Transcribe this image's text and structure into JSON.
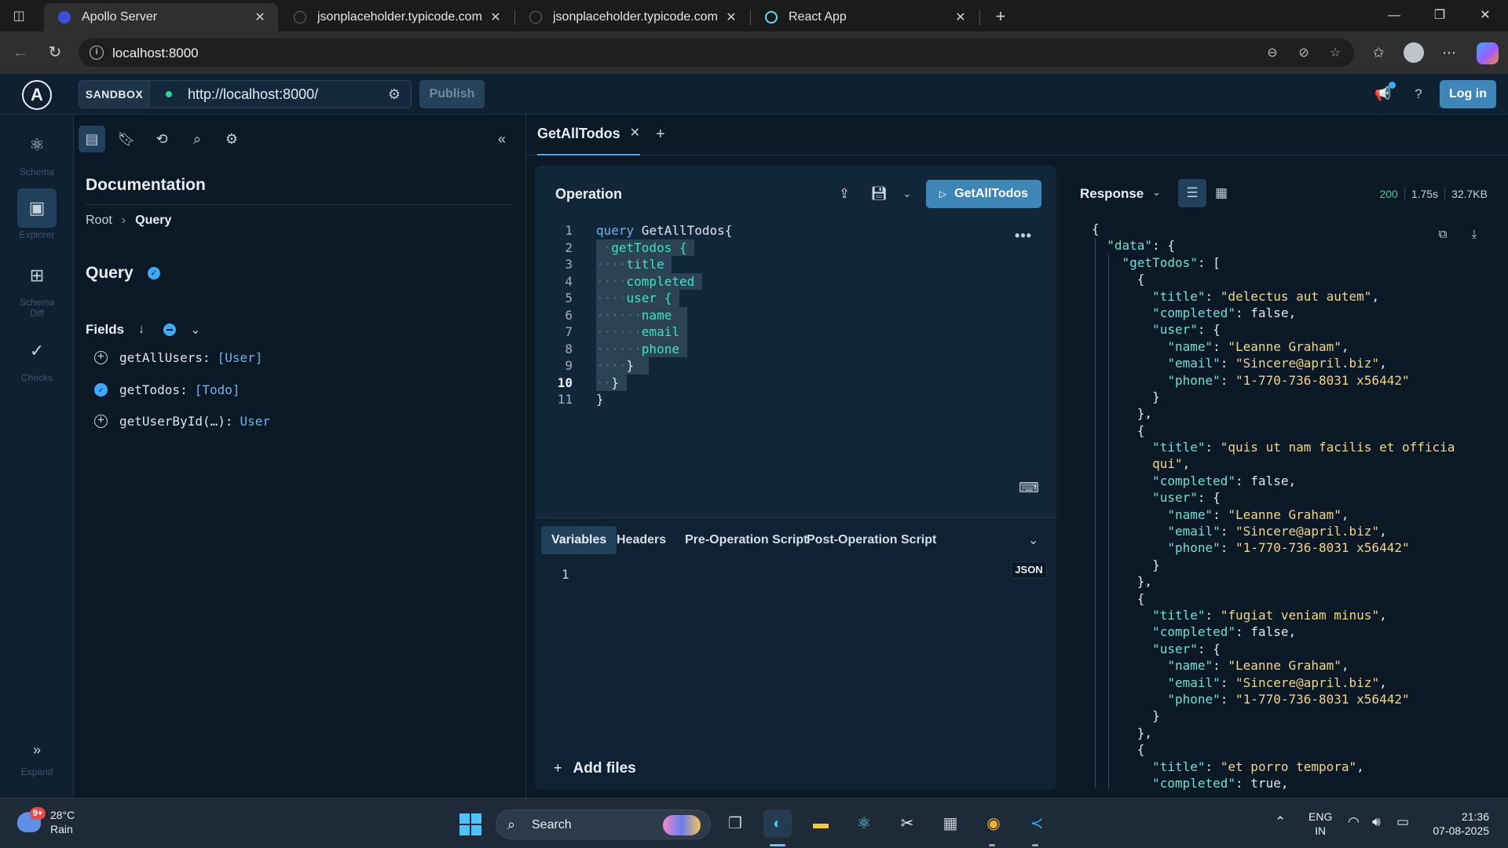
{
  "browser": {
    "tabs": [
      {
        "title": "Apollo Server",
        "active": true
      },
      {
        "title": "jsonplaceholder.typicode.com/to",
        "active": false
      },
      {
        "title": "jsonplaceholder.typicode.com/us",
        "active": false
      },
      {
        "title": "React App",
        "active": false
      }
    ],
    "address": "localhost:8000"
  },
  "header": {
    "sandbox_label": "SANDBOX",
    "endpoint": "http://localhost:8000/",
    "publish_label": "Publish",
    "login_label": "Log in"
  },
  "leftnav": {
    "items": [
      {
        "label": "Schema",
        "icon": "schema-icon"
      },
      {
        "label": "Explorer",
        "icon": "explorer-icon"
      },
      {
        "label": "Schema Diff",
        "icon": "schema-diff-icon"
      },
      {
        "label": "Checks",
        "icon": "checks-icon"
      }
    ],
    "expand_label": "Expand"
  },
  "docs": {
    "title": "Documentation",
    "breadcrumb": [
      "Root",
      "Query"
    ],
    "query_title": "Query",
    "fields_label": "Fields",
    "fields": [
      {
        "name": "getAllUsers:",
        "type": "[User]",
        "selected": false
      },
      {
        "name": "getTodos:",
        "type": "[Todo]",
        "selected": true
      },
      {
        "name": "getUserById(…):",
        "type": "User",
        "selected": false
      }
    ]
  },
  "operation_tab": {
    "label": "GetAllTodos"
  },
  "operation": {
    "title": "Operation",
    "run_label": "GetAllTodos",
    "line_numbers": [
      "1",
      "2",
      "3",
      "4",
      "5",
      "6",
      "7",
      "8",
      "9",
      "10",
      "11"
    ],
    "code": {
      "l1_kw": "query",
      "l1_name": " GetAllTodos{",
      "l2": "getTodos {",
      "l3": "title",
      "l4": "completed",
      "l5": "user {",
      "l6": "name",
      "l7": "email",
      "l8": "phone",
      "l9": "}",
      "l10": "}",
      "l11": "}"
    }
  },
  "variables": {
    "tabs": [
      "Variables",
      "Headers",
      "Pre-Operation Script",
      "Post-Operation Script"
    ],
    "badge": "JSON",
    "line1": "1",
    "add_files_label": "Add files"
  },
  "response": {
    "label": "Response",
    "status": "200",
    "time": "1.75s",
    "size": "32.7KB",
    "todos": [
      {
        "title": "delectus aut autem",
        "completed": "false",
        "name": "Leanne Graham",
        "email": "Sincere@april.biz",
        "phone": "1-770-736-8031 x56442"
      },
      {
        "title_a": "quis ut nam facilis et officia",
        "title_b": "qui",
        "completed": "false",
        "name": "Leanne Graham",
        "email": "Sincere@april.biz",
        "phone": "1-770-736-8031 x56442"
      },
      {
        "title": "fugiat veniam minus",
        "completed": "false",
        "name": "Leanne Graham",
        "email": "Sincere@april.biz",
        "phone": "1-770-736-8031 x56442"
      },
      {
        "title": "et porro tempora",
        "completed": "true"
      }
    ]
  },
  "taskbar": {
    "weather_temp": "28°C",
    "weather_desc": "Rain",
    "weather_badge": "9+",
    "search_label": "Search",
    "lang_1": "ENG",
    "lang_2": "IN",
    "time": "21:36",
    "date": "07-08-2025"
  }
}
